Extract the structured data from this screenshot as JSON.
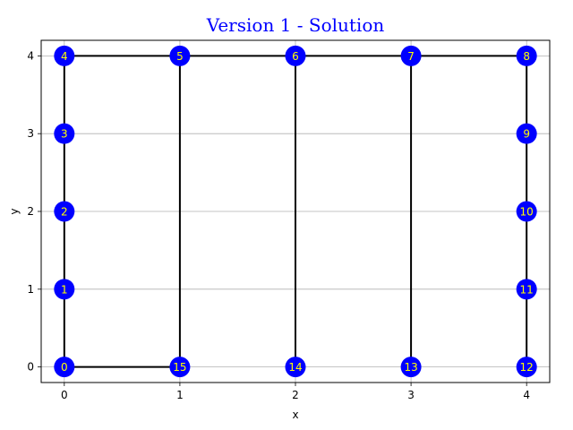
{
  "chart_data": {
    "type": "scatter",
    "title": "Version 1 - Solution",
    "xlabel": "x",
    "ylabel": "y",
    "xlim": [
      -0.2,
      4.2
    ],
    "ylim": [
      -0.2,
      4.2
    ],
    "xticks": [
      0,
      1,
      2,
      3,
      4
    ],
    "yticks": [
      0,
      1,
      2,
      3,
      4
    ],
    "grid": true,
    "colors": {
      "title": "#0000ff",
      "node": "#0000ff",
      "node_label": "#ffff00",
      "edge": "#000000",
      "grid": "#b0b0b0"
    },
    "nodes": [
      {
        "id": "0",
        "x": 0,
        "y": 0
      },
      {
        "id": "1",
        "x": 0,
        "y": 1
      },
      {
        "id": "2",
        "x": 0,
        "y": 2
      },
      {
        "id": "3",
        "x": 0,
        "y": 3
      },
      {
        "id": "4",
        "x": 0,
        "y": 4
      },
      {
        "id": "5",
        "x": 1,
        "y": 4
      },
      {
        "id": "6",
        "x": 2,
        "y": 4
      },
      {
        "id": "7",
        "x": 3,
        "y": 4
      },
      {
        "id": "8",
        "x": 4,
        "y": 4
      },
      {
        "id": "9",
        "x": 4,
        "y": 3
      },
      {
        "id": "10",
        "x": 4,
        "y": 2
      },
      {
        "id": "11",
        "x": 4,
        "y": 1
      },
      {
        "id": "12",
        "x": 4,
        "y": 0
      },
      {
        "id": "13",
        "x": 3,
        "y": 0
      },
      {
        "id": "14",
        "x": 2,
        "y": 0
      },
      {
        "id": "15",
        "x": 1,
        "y": 0
      }
    ],
    "edges": [
      [
        "0",
        "1"
      ],
      [
        "1",
        "2"
      ],
      [
        "2",
        "3"
      ],
      [
        "3",
        "4"
      ],
      [
        "4",
        "5"
      ],
      [
        "5",
        "6"
      ],
      [
        "6",
        "7"
      ],
      [
        "7",
        "8"
      ],
      [
        "8",
        "9"
      ],
      [
        "9",
        "10"
      ],
      [
        "10",
        "11"
      ],
      [
        "11",
        "12"
      ],
      [
        "0",
        "15"
      ],
      [
        "5",
        "15"
      ],
      [
        "6",
        "14"
      ],
      [
        "7",
        "13"
      ]
    ]
  }
}
